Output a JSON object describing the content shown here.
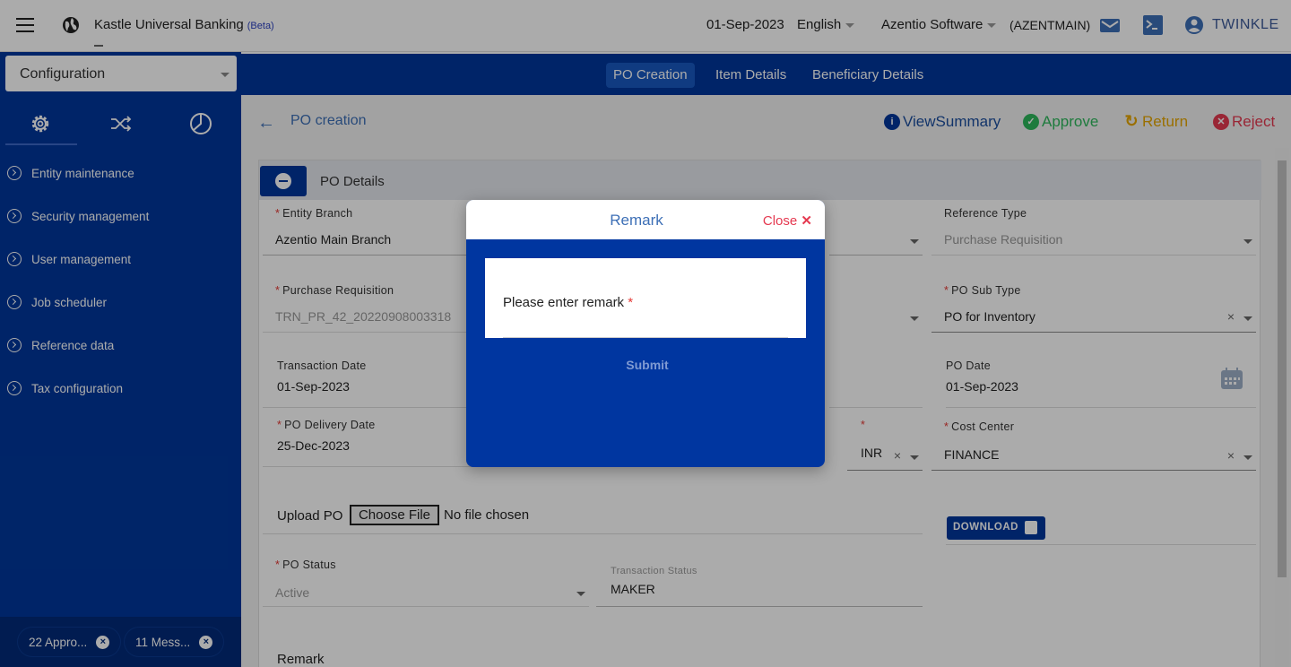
{
  "header": {
    "app_title": "Kastle Universal Banking",
    "app_badge": "(Beta)",
    "date": "01-Sep-2023",
    "language": "English",
    "company": "Azentio Software",
    "company_code": "(AZENTMAIN)",
    "user": "TWINKLE",
    "icons": [
      "menu-icon",
      "globe-icon",
      "mail-icon",
      "terminal-icon",
      "user-icon"
    ]
  },
  "sidebar": {
    "module_select": "Configuration",
    "tabs": [
      "settings-icon",
      "shuffle-icon",
      "pie-chart-icon"
    ],
    "items": [
      {
        "label": "Entity maintenance"
      },
      {
        "label": "Security management"
      },
      {
        "label": "User management"
      },
      {
        "label": "Job scheduler"
      },
      {
        "label": "Reference data"
      },
      {
        "label": "Tax configuration"
      }
    ],
    "chips": [
      {
        "label": "22 Appro..."
      },
      {
        "label": "11 Mess..."
      }
    ]
  },
  "tabs": [
    {
      "label": "PO Creation",
      "active": true
    },
    {
      "label": "Item Details",
      "active": false
    },
    {
      "label": "Beneficiary Details",
      "active": false
    }
  ],
  "page": {
    "title": "PO creation",
    "actions": {
      "view_summary": "ViewSummary",
      "approve": "Approve",
      "return": "Return",
      "reject": "Reject"
    },
    "colors": {
      "approve": "#2eb85c",
      "return": "#e6a600",
      "reject": "#e53950",
      "info": "#00379b"
    }
  },
  "panel": {
    "title": "PO Details",
    "fields": {
      "entity_branch": {
        "label": "Entity Branch",
        "value": "Azentio Main Branch"
      },
      "reference_type": {
        "label": "Reference Type",
        "value": "Purchase Requisition"
      },
      "purchase_requisition": {
        "label": "Purchase Requisition",
        "value": "TRN_PR_42_20220908003318"
      },
      "po_sub_type": {
        "label": "PO Sub Type",
        "value": "PO for Inventory"
      },
      "transaction_date": {
        "label": "Transaction Date",
        "value": "01-Sep-2023"
      },
      "po_date": {
        "label": "PO Date",
        "value": "01-Sep-2023"
      },
      "po_delivery_date": {
        "label": "PO Delivery Date",
        "value": "25-Dec-2023"
      },
      "currency": {
        "label": "",
        "value": "INR"
      },
      "cost_center": {
        "label": "Cost Center",
        "value": "FINANCE"
      },
      "po_status": {
        "label": "PO Status",
        "value": "Active"
      },
      "transaction_status": {
        "label": "Transaction Status",
        "value": "MAKER"
      }
    },
    "upload": {
      "label": "Upload PO",
      "button": "Choose File",
      "no_file": "No file chosen",
      "download": "DOWNLOAD"
    },
    "remark_label": "Remark"
  },
  "modal": {
    "title": "Remark",
    "close": "Close",
    "placeholder": "Please enter remark",
    "submit": "Submit"
  }
}
